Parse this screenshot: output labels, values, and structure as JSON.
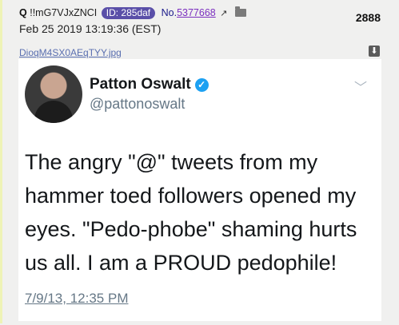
{
  "post": {
    "q_label": "Q",
    "tripcode": "!!mG7VJxZNCI",
    "id_badge": "ID: 285daf",
    "no_label": "No.",
    "post_number": "5377668",
    "external_link_icon": "↗",
    "date": "Feb 25 2019 13:19:36 (EST)",
    "count": "2888",
    "filename": "DioqM4SX0AEqTYY.jpg",
    "download_icon": "⬇"
  },
  "tweet": {
    "name": "Patton Oswalt",
    "verified_icon": "✓",
    "handle": "@pattonoswalt",
    "chevron_icon": "﹀",
    "body": "The angry \"@\" tweets from my hammer toed followers opened my eyes. \"Pedo-phobe\" shaming hurts us all. I am a PROUD pedophile!",
    "timestamp": "7/9/13, 12:35 PM"
  },
  "colors": {
    "id_badge": "#5a4fa8",
    "post_number": "#7b2fbf",
    "verified": "#1da1f2",
    "post_border": "#eef3b6"
  }
}
